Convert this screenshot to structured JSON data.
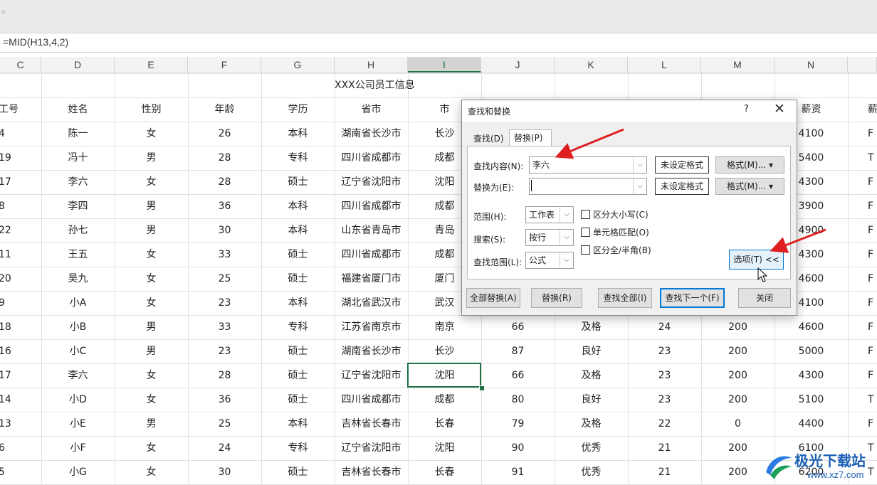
{
  "ribbon": {
    "mark": "▫"
  },
  "formula": "=MID(H13,4,2)",
  "columns": [
    "C",
    "D",
    "E",
    "F",
    "G",
    "H",
    "I",
    "J",
    "K",
    "L",
    "M",
    "N",
    ""
  ],
  "sheet_title": "XXX公司员工信息",
  "headers": [
    "工号",
    "姓名",
    "性别",
    "年龄",
    "学历",
    "省市",
    "市",
    "",
    "",
    "",
    "",
    "薪资",
    "薪资"
  ],
  "rows": [
    [
      "4",
      "陈一",
      "女",
      "26",
      "本科",
      "湖南省长沙市",
      "长沙",
      "",
      "",
      "",
      "",
      "4100",
      "F"
    ],
    [
      "19",
      "冯十",
      "男",
      "28",
      "专科",
      "四川省成都市",
      "成都",
      "",
      "",
      "",
      "",
      "5400",
      "T"
    ],
    [
      "17",
      "李六",
      "女",
      "28",
      "硕士",
      "辽宁省沈阳市",
      "沈阳",
      "",
      "",
      "",
      "",
      "4300",
      "F"
    ],
    [
      "8",
      "李四",
      "男",
      "36",
      "本科",
      "四川省成都市",
      "成都",
      "",
      "",
      "",
      "",
      "3900",
      "F"
    ],
    [
      "22",
      "孙七",
      "男",
      "30",
      "本科",
      "山东省青岛市",
      "青岛",
      "",
      "",
      "",
      "",
      "4900",
      "F"
    ],
    [
      "11",
      "王五",
      "女",
      "33",
      "硕士",
      "四川省成都市",
      "成都",
      "",
      "",
      "",
      "",
      "4300",
      "F"
    ],
    [
      "20",
      "吴九",
      "女",
      "25",
      "硕士",
      "福建省厦门市",
      "厦门",
      "",
      "",
      "",
      "",
      "4600",
      "F"
    ],
    [
      "9",
      "小A",
      "女",
      "23",
      "本科",
      "湖北省武汉市",
      "武汉",
      "",
      "",
      "",
      "",
      "4100",
      "F"
    ],
    [
      "18",
      "小B",
      "男",
      "33",
      "专科",
      "江苏省南京市",
      "南京",
      "66",
      "及格",
      "24",
      "200",
      "4600",
      "F"
    ],
    [
      "16",
      "小C",
      "男",
      "23",
      "硕士",
      "湖南省长沙市",
      "长沙",
      "87",
      "良好",
      "23",
      "200",
      "5000",
      "F"
    ],
    [
      "17",
      "李六",
      "女",
      "28",
      "硕士",
      "辽宁省沈阳市",
      "沈阳",
      "66",
      "及格",
      "23",
      "200",
      "4300",
      "F"
    ],
    [
      "14",
      "小D",
      "女",
      "36",
      "硕士",
      "四川省成都市",
      "成都",
      "80",
      "良好",
      "23",
      "200",
      "5100",
      "T"
    ],
    [
      "13",
      "小E",
      "男",
      "25",
      "本科",
      "吉林省长春市",
      "长春",
      "79",
      "及格",
      "22",
      "0",
      "4400",
      "F"
    ],
    [
      "6",
      "小F",
      "女",
      "24",
      "专科",
      "辽宁省沈阳市",
      "沈阳",
      "90",
      "优秀",
      "21",
      "200",
      "6100",
      "T"
    ],
    [
      "5",
      "小G",
      "女",
      "30",
      "硕士",
      "吉林省长春市",
      "长春",
      "91",
      "优秀",
      "21",
      "200",
      "6200",
      "T"
    ]
  ],
  "dialog": {
    "title": "查找和替换",
    "help": "?",
    "close": "✕",
    "tab_find": "查找(D)",
    "tab_replace": "替换(P)",
    "find_label": "查找内容(N):",
    "find_value": "李六",
    "replace_label": "替换为(E):",
    "replace_value": "",
    "no_format_1": "未设定格式",
    "no_format_2": "未设定格式",
    "format_btn_1": "格式(M)...",
    "format_btn_2": "格式(M)...",
    "scope_label": "范围(H):",
    "scope_value": "工作表",
    "search_label": "搜索(S):",
    "search_value": "按行",
    "lookin_label": "查找范围(L):",
    "lookin_value": "公式",
    "match_case": "区分大小写(C)",
    "match_cell": "单元格匹配(O)",
    "match_width": "区分全/半角(B)",
    "options_btn": "选项(T) <<",
    "replace_all": "全部替换(A)",
    "replace": "替换(R)",
    "find_all": "查找全部(I)",
    "find_next": "查找下一个(F)",
    "close_btn": "关闭"
  },
  "watermark": {
    "name": "极光下载站",
    "url": "www.xz7.com"
  },
  "colors": {
    "accent": "#217346",
    "dialog_focus": "#0078d7",
    "arrow": "#e02020"
  }
}
